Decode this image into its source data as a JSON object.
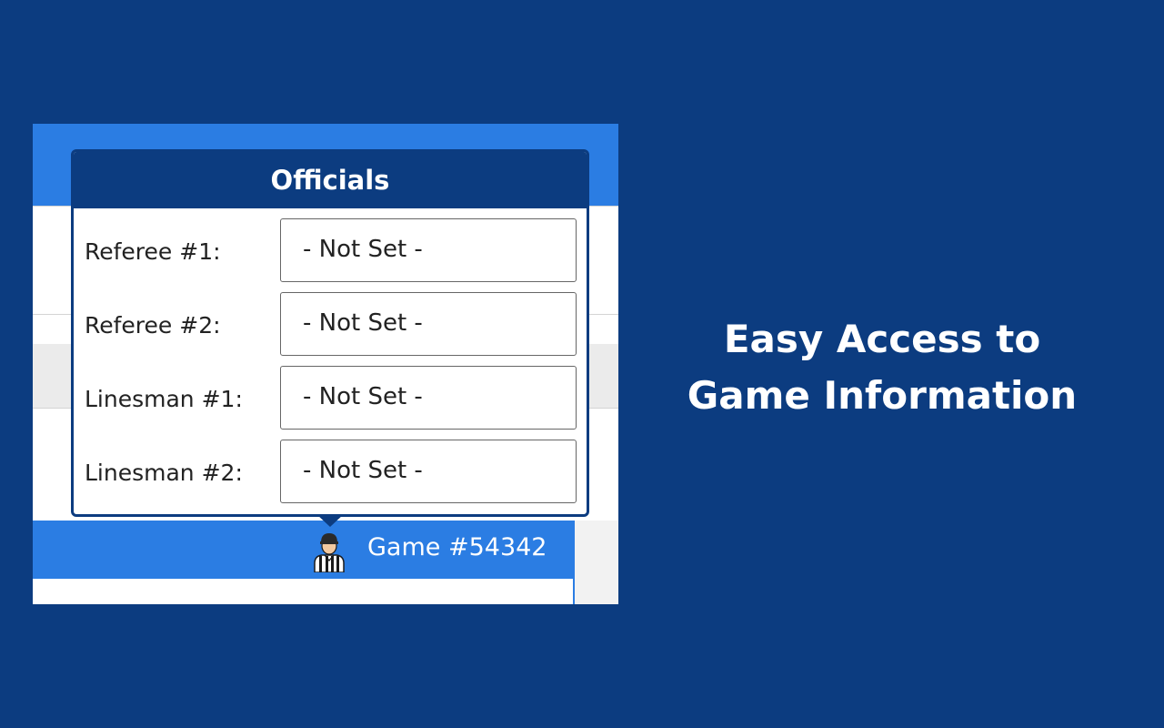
{
  "popup": {
    "title": "Officials",
    "fields": [
      {
        "label": "Referee #1:",
        "value": "- Not Set -"
      },
      {
        "label": "Referee #2:",
        "value": "- Not Set -"
      },
      {
        "label": "Linesman #1:",
        "value": "- Not Set -"
      },
      {
        "label": "Linesman #2:",
        "value": "- Not Set -"
      }
    ]
  },
  "game": {
    "label": "Game #54342",
    "icon": "referee-icon"
  },
  "headline": {
    "line1": "Easy Access to",
    "line2": "Game Information"
  },
  "colors": {
    "background": "#0c3c80",
    "accent_blue": "#2b7de3",
    "popup_header": "#0c3c80"
  }
}
